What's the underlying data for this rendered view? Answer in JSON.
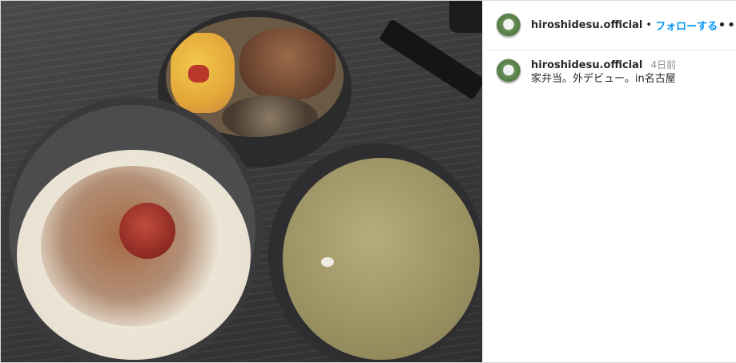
{
  "post": {
    "image_alt": "",
    "author": "hiroshidesu.official",
    "separator": "•",
    "follow_label": "フォローする",
    "more_icon": "more-horizontal-icon",
    "caption": {
      "author": "hiroshidesu.official",
      "time_ago": "4日前",
      "text": "家弁当。外デビュー。in名古屋"
    }
  },
  "colors": {
    "follow_blue": "#0095f6",
    "text": "#262626",
    "muted": "#8e8e8e",
    "border": "#dbdbdb"
  }
}
